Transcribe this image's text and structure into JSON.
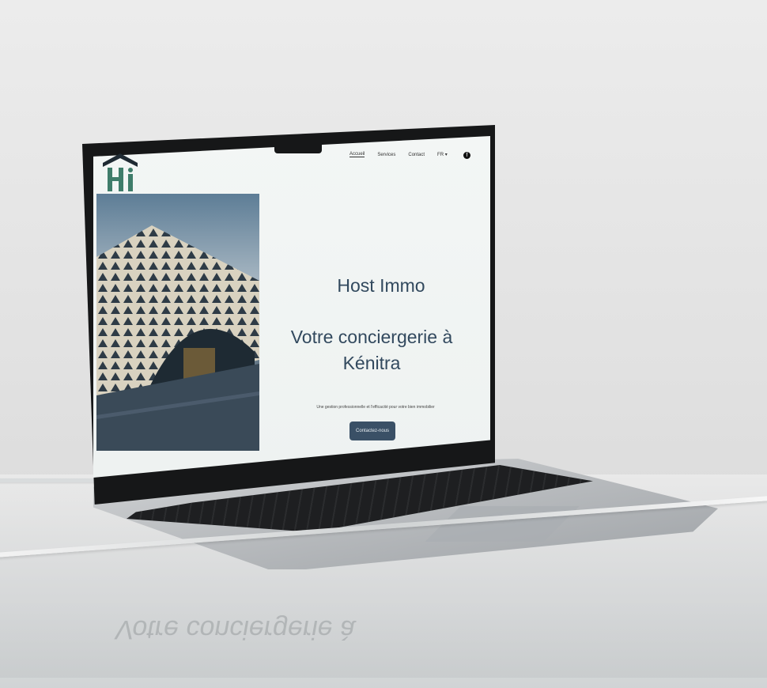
{
  "site": {
    "logo_text": "Hi",
    "nav": [
      {
        "label": "Accueil",
        "active": true
      },
      {
        "label": "Services",
        "active": false
      },
      {
        "label": "Contact",
        "active": false
      },
      {
        "label": "FR ▾",
        "active": false
      }
    ],
    "social_icon": "facebook-icon",
    "hero": {
      "title": "Host Immo",
      "subtitle": "Votre conciergerie à Kénitra",
      "tagline": "Une gestion professionnelle et l'efficacité pour votre bien immobilier",
      "cta_label": "Contactez-nous"
    },
    "colors": {
      "primary": "#32495E",
      "button": "#3A5066",
      "logo_green": "#3F7D6A",
      "background": "#EEF2F1"
    }
  },
  "reflection_text": "Votre conciergerie à"
}
